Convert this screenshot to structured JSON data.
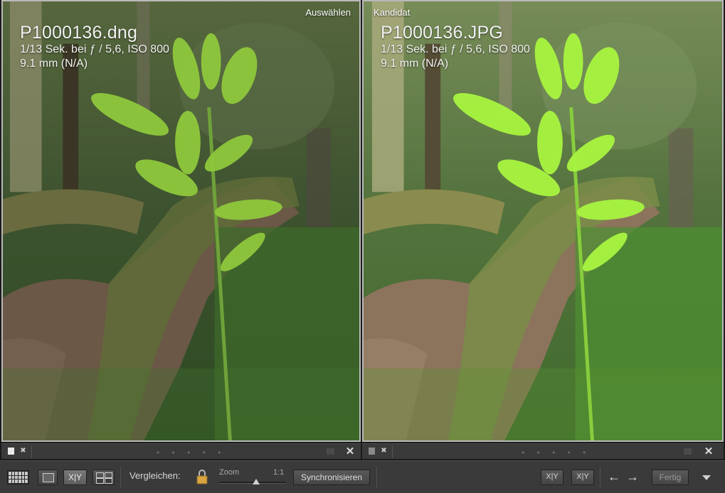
{
  "left_pane": {
    "tag": "Auswählen",
    "filename": "P1000136.dng",
    "exposure": "1/13 Sek. bei ƒ / 5,6, ISO 800",
    "lens": "9.1 mm (N/A)"
  },
  "right_pane": {
    "tag": "Kandidat",
    "filename": "P1000136.JPG",
    "exposure": "1/13 Sek. bei ƒ / 5,6, ISO 800",
    "lens": "9.1 mm (N/A)"
  },
  "pane_bar": {
    "dots": "• • • • •",
    "close": "✕",
    "reject": "✖"
  },
  "toolbar": {
    "xy_label": "X|Y",
    "compare_label": "Vergleichen:",
    "zoom_label": "Zoom",
    "zoom_value": "1:1",
    "zoom_level": 0.55,
    "sync_label": "Synchronisieren",
    "swap_label": "X|Y",
    "select_label": "X|Y",
    "prev": "←",
    "next": "→",
    "done_label": "Fertig"
  },
  "colors": {
    "accent": "#b9b9b9",
    "toolbar_bg": "#3a3a3a"
  }
}
